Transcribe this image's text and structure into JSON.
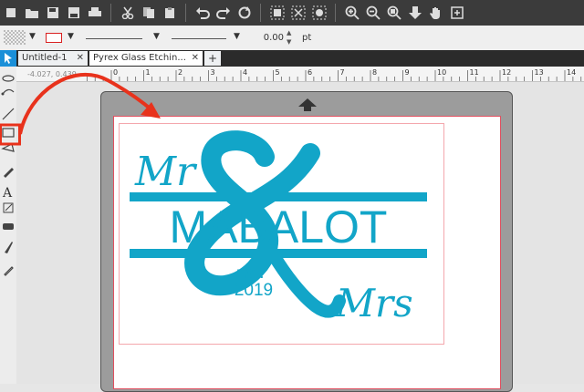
{
  "toolbar": {
    "icons": [
      "new-file-icon",
      "open-folder-icon",
      "save-icon",
      "save-as-icon",
      "print-icon",
      "cut-icon",
      "copy-icon",
      "paste-icon",
      "undo-icon",
      "redo-icon",
      "refresh-icon",
      "group-icon",
      "ungroup-icon",
      "select-all-icon",
      "zoom-in-icon",
      "zoom-out-icon",
      "zoom-fit-icon",
      "move-down-icon",
      "pan-hand-icon",
      "add-page-icon"
    ]
  },
  "properties": {
    "line_width_value": "0.00",
    "line_width_unit": "pt"
  },
  "tabs": [
    {
      "label": "Untitled-1",
      "close": "✕"
    },
    {
      "label": "Pyrex Glass Etchin...",
      "close": "✕"
    }
  ],
  "add_tab_label": "+",
  "ruler": {
    "coords": "-4.027, 0.439",
    "ticks": [
      "0",
      "1",
      "2",
      "3",
      "4",
      "5",
      "6",
      "7",
      "8",
      "9",
      "10",
      "11",
      "12",
      "13",
      "14"
    ]
  },
  "design": {
    "big_text": "MABALOT",
    "mr": "Mr",
    "mrs": "Mrs",
    "est": "EST.",
    "year": "2019",
    "color": "#12a5c8"
  },
  "colors": {
    "accent_arrow": "#e8321c",
    "paper_border": "#e15060"
  }
}
